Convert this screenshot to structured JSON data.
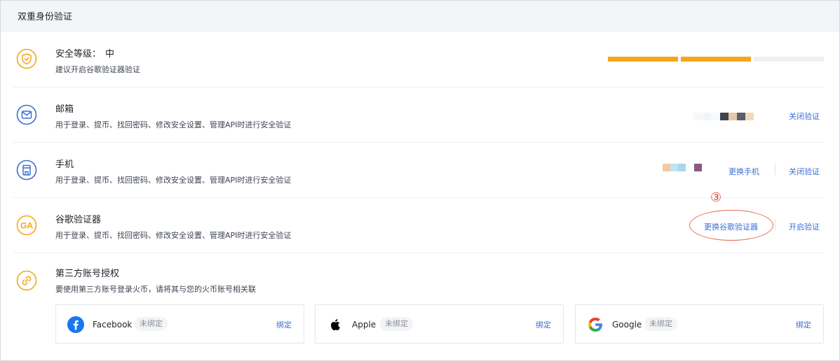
{
  "header": {
    "title": "双重身份验证"
  },
  "security_level": {
    "label": "安全等级：",
    "value": "中",
    "hint": "建议开启谷歌验证器验证",
    "filled_segments": 2,
    "total_segments": 3,
    "fill_color": "#f6a51b",
    "empty_color": "#eef0f3",
    "icon": "shield-check-icon"
  },
  "items": [
    {
      "name": "邮箱",
      "desc": "用于登录、提币、找回密码、修改安全设置、管理API时进行安全验证",
      "icon": "email-icon",
      "actions": [
        "关闭验证"
      ]
    },
    {
      "name": "手机",
      "desc": "用于登录、提币、找回密码、修改安全设置、管理API时进行安全验证",
      "icon": "phone-icon",
      "actions": [
        "更换手机",
        "关闭验证"
      ]
    },
    {
      "name": "谷歌验证器",
      "desc": "用于登录、提币、找回密码、修改安全设置、管理API时进行安全验证",
      "icon": "google-authenticator-icon",
      "actions": [
        "更换谷歌验证器",
        "开启验证"
      ]
    }
  ],
  "third_party": {
    "name": "第三方账号授权",
    "desc": "要使用第三方账号登录火币，请将其与您的火币账号相关联",
    "icon": "link-icon",
    "accounts": [
      {
        "name": "Facebook",
        "status": "未绑定",
        "action": "绑定",
        "icon": "facebook-icon"
      },
      {
        "name": "Apple",
        "status": "未绑定",
        "action": "绑定",
        "icon": "apple-icon"
      },
      {
        "name": "Google",
        "status": "未绑定",
        "action": "绑定",
        "icon": "google-icon"
      }
    ]
  },
  "annotation": {
    "number": "③"
  },
  "colors": {
    "accent": "#3b6fd6",
    "warning": "#f6a51b",
    "annotation": "#e0473a"
  }
}
